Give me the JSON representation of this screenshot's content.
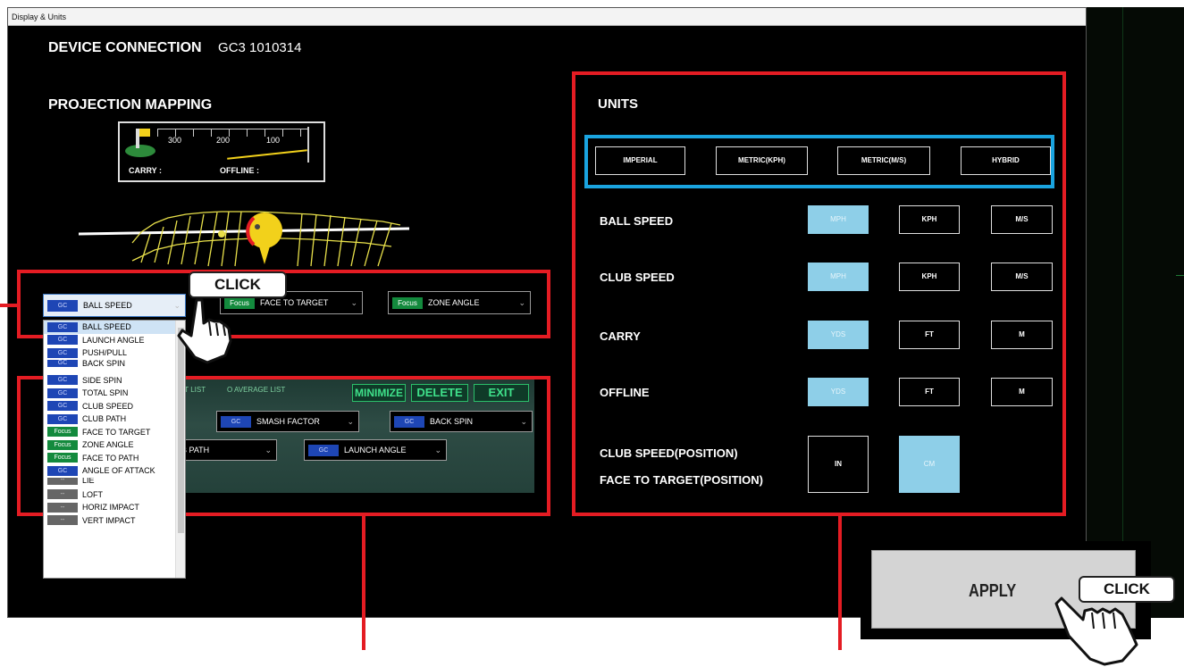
{
  "window": {
    "title": "Display & Units"
  },
  "device": {
    "label": "DEVICE CONNECTION",
    "value": "GC3 1010314"
  },
  "projection": {
    "title": "PROJECTION MAPPING",
    "distance_ticks": [
      "300",
      "200",
      "100"
    ],
    "carry_label": "CARRY  :",
    "offline_label": "OFFLINE :"
  },
  "selectors": {
    "top": [
      {
        "tag": "GC",
        "label": "BALL SPEED"
      },
      {
        "tag": "Focus",
        "label": "FACE TO TARGET"
      },
      {
        "tag": "Focus",
        "label": "ZONE ANGLE"
      }
    ],
    "options": [
      {
        "tag": "GC",
        "label": "BALL SPEED"
      },
      {
        "tag": "GC",
        "label": "LAUNCH ANGLE"
      },
      {
        "tag": "GC",
        "label": "PUSH/PULL"
      },
      {
        "tag": "GC",
        "label": "BACK SPIN"
      },
      {
        "tag": "GC",
        "label": "SIDE SPIN"
      },
      {
        "tag": "GC",
        "label": "TOTAL SPIN"
      },
      {
        "tag": "GC",
        "label": "CLUB SPEED"
      },
      {
        "tag": "GC",
        "label": "CLUB PATH"
      },
      {
        "tag": "Focus",
        "label": "FACE TO TARGET"
      },
      {
        "tag": "Focus",
        "label": "ZONE ANGLE"
      },
      {
        "tag": "Focus",
        "label": "FACE TO PATH"
      },
      {
        "tag": "GC",
        "label": "ANGLE OF ATTACK"
      },
      {
        "tag": "--",
        "label": "LIE"
      },
      {
        "tag": "--",
        "label": "LOFT"
      },
      {
        "tag": "--",
        "label": "HORIZ IMPACT"
      },
      {
        "tag": "--",
        "label": "VERT IMPACT"
      }
    ]
  },
  "list_panel": {
    "shot_list": "OT LIST",
    "average_list": "O AVERAGE LIST",
    "minimize": "MINIMIZE",
    "delete": "DELETE",
    "exit": "EXIT",
    "row1": [
      {
        "tag": "GC",
        "label": "SMASH FACTOR"
      },
      {
        "tag": "GC",
        "label": "BACK SPIN"
      }
    ],
    "row2": [
      {
        "label": "B PATH"
      },
      {
        "tag": "GC",
        "label": "LAUNCH ANGLE"
      }
    ]
  },
  "units": {
    "title": "UNITS",
    "presets": [
      "IMPERIAL",
      "METRIC(KPH)",
      "METRIC(M/S)",
      "HYBRID"
    ],
    "rows": [
      {
        "label": "BALL SPEED",
        "options": [
          "MPH",
          "KPH",
          "M/S"
        ],
        "selected": "MPH"
      },
      {
        "label": "CLUB SPEED",
        "options": [
          "MPH",
          "KPH",
          "M/S"
        ],
        "selected": "MPH"
      },
      {
        "label": "CARRY",
        "options": [
          "YDS",
          "FT",
          "M"
        ],
        "selected": "YDS"
      },
      {
        "label": "OFFLINE",
        "options": [
          "YDS",
          "FT",
          "M"
        ],
        "selected": "YDS"
      }
    ],
    "position_label_1": "CLUB SPEED(POSITION)",
    "position_label_2": "FACE TO TARGET(POSITION)",
    "position_options": [
      "IN",
      "CM"
    ],
    "position_selected": "CM"
  },
  "apply": {
    "label": "APPLY"
  },
  "callouts": {
    "click_1": "CLICK",
    "click_2": "CLICK"
  },
  "colors": {
    "highlight_red": "#e41c23",
    "highlight_blue": "#1aa4e0",
    "selected_unit": "#8ecfe8",
    "gc_tag": "#1e46b5",
    "focus_tag": "#138a3d"
  }
}
